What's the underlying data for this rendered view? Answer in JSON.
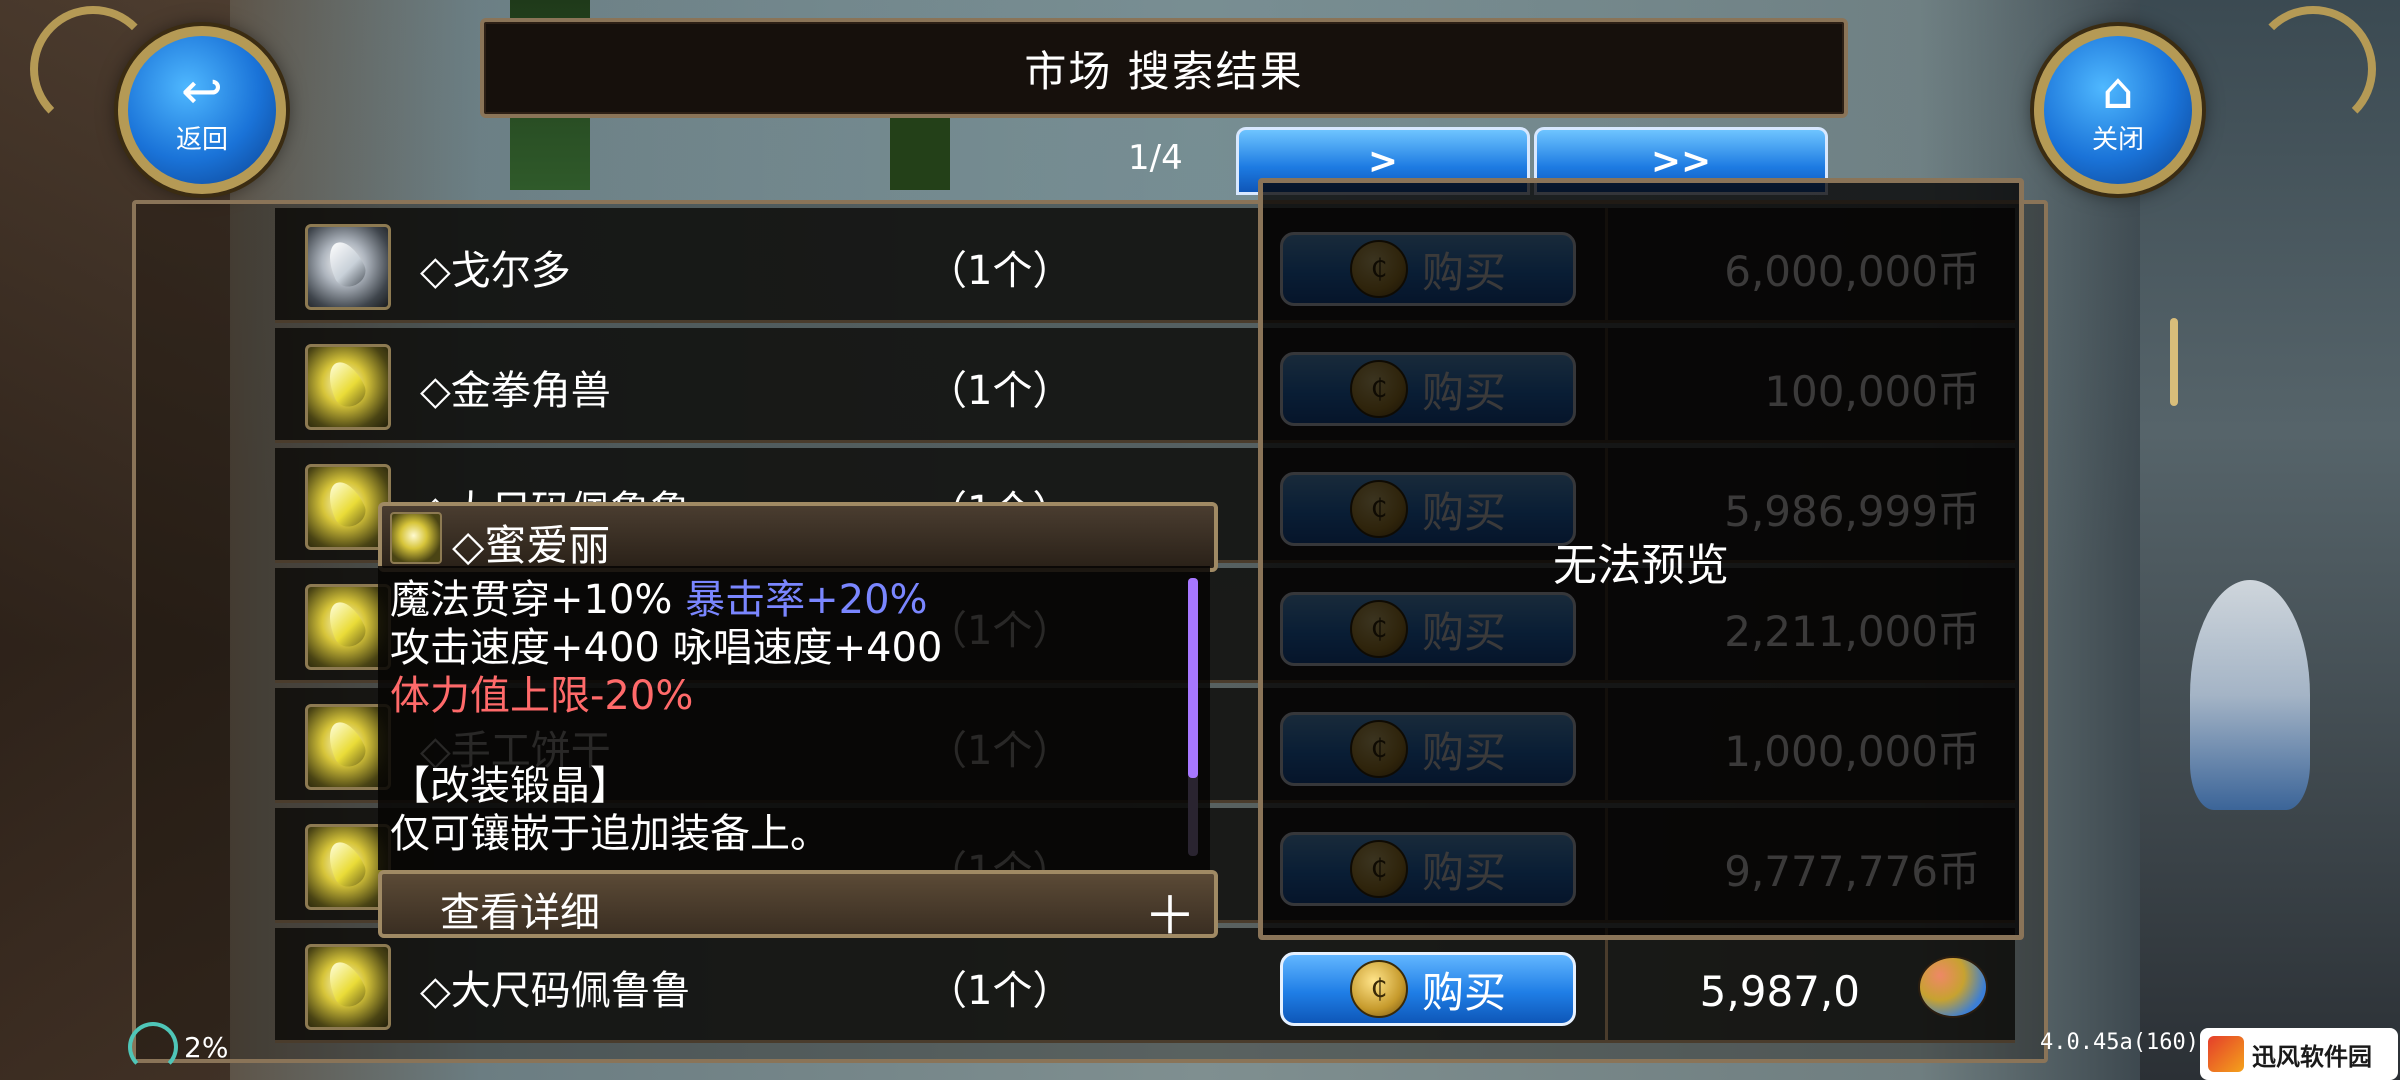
{
  "header": {
    "title": "市场 搜索结果",
    "back_label": "返回",
    "close_label": "关闭"
  },
  "pagination": {
    "page": "1/4",
    "next": ">",
    "last": ">>"
  },
  "preview": {
    "text": "无法预览"
  },
  "rows": [
    {
      "name": "◇戈尔多",
      "qty": "（1个）",
      "buy": "购买",
      "price": "6,000,000币",
      "icon": "silver-crystal"
    },
    {
      "name": "◇金拳角兽",
      "qty": "（1个）",
      "buy": "购买",
      "price": "100,000币",
      "icon": "gold-crystal"
    },
    {
      "name": "◇大尺码佩鲁鲁",
      "qty": "（1个）",
      "buy": "购买",
      "price": "5,986,999币",
      "icon": "gold-crystal"
    },
    {
      "name": "",
      "qty": "（1个）",
      "buy": "购买",
      "price": "2,211,000币",
      "icon": "gold-crystal"
    },
    {
      "name": "◇手工饼干",
      "qty": "（1个）",
      "buy": "购买",
      "price": "1,000,000币",
      "icon": "gold-crystal"
    },
    {
      "name": "",
      "qty": "（1个）",
      "buy": "购买",
      "price": "9,777,776币",
      "icon": "gold-crystal"
    },
    {
      "name": "◇大尺码佩鲁鲁",
      "qty": "（1个）",
      "buy": "购买",
      "price": "5,987,0",
      "price_tail": "币",
      "icon": "gold-crystal"
    }
  ],
  "tooltip": {
    "name": "◇蜜爱丽",
    "line1a": "魔法贯穿+10%",
    "line1b": "暴击率+20%",
    "line2": "攻击速度+400 咏唱速度+400",
    "line3": "体力值上限-20%",
    "line4": "【改装锻晶】",
    "line5": "仅可镶嵌于追加装备上。",
    "footer": "查看详细",
    "plus": "＋"
  },
  "status": {
    "signal": "2%",
    "version": "4.0.45a(160)"
  },
  "watermark": {
    "text": "迅风软件园"
  },
  "colors": {
    "button_blue": "#1f7ee6",
    "frame_gold": "#8a7458",
    "stat_blue": "#7a86ff",
    "stat_red": "#ff6a6a"
  }
}
